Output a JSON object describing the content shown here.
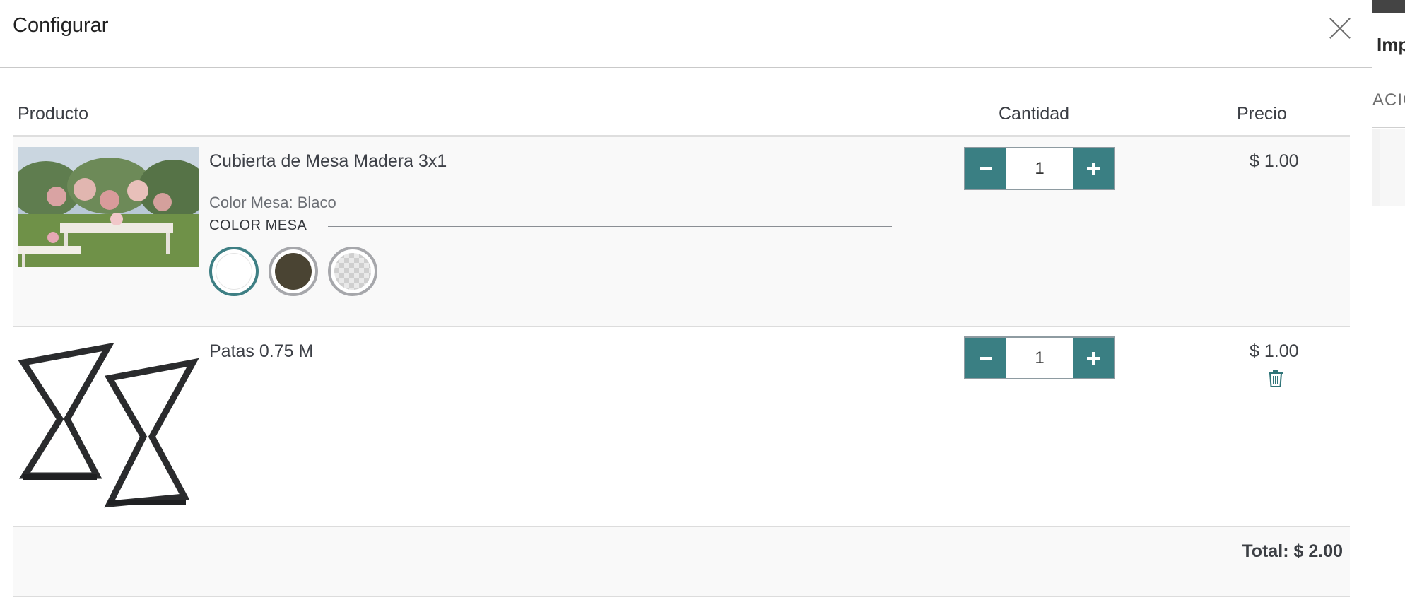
{
  "modal": {
    "title": "Configurar"
  },
  "table": {
    "headers": {
      "product": "Producto",
      "quantity": "Cantidad",
      "price": "Precio"
    }
  },
  "items": [
    {
      "name": "Cubierta de Mesa Madera 3x1",
      "attribute_text": "Color Mesa: Blaco",
      "attribute_label": "COLOR MESA",
      "swatches": [
        {
          "name": "Blanco",
          "color": "#ffffff",
          "selected": true
        },
        {
          "name": "Café oscuro",
          "color": "#4a4433",
          "selected": false
        },
        {
          "name": "Transparente",
          "color": "checker",
          "selected": false
        }
      ],
      "quantity": "1",
      "price": "$ 1.00"
    },
    {
      "name": "Patas 0.75 M",
      "quantity": "1",
      "price": "$ 1.00"
    }
  ],
  "total": "Total: $ 2.00",
  "background": {
    "top_label": "Imp",
    "sub_label": "ACIÓ"
  },
  "colors": {
    "accent": "#3a7f83",
    "selected_border": "#3e7f84",
    "row_bg": "#f9f9f9"
  },
  "icons": [
    "close-icon",
    "minus-icon",
    "plus-icon",
    "trash-icon"
  ]
}
